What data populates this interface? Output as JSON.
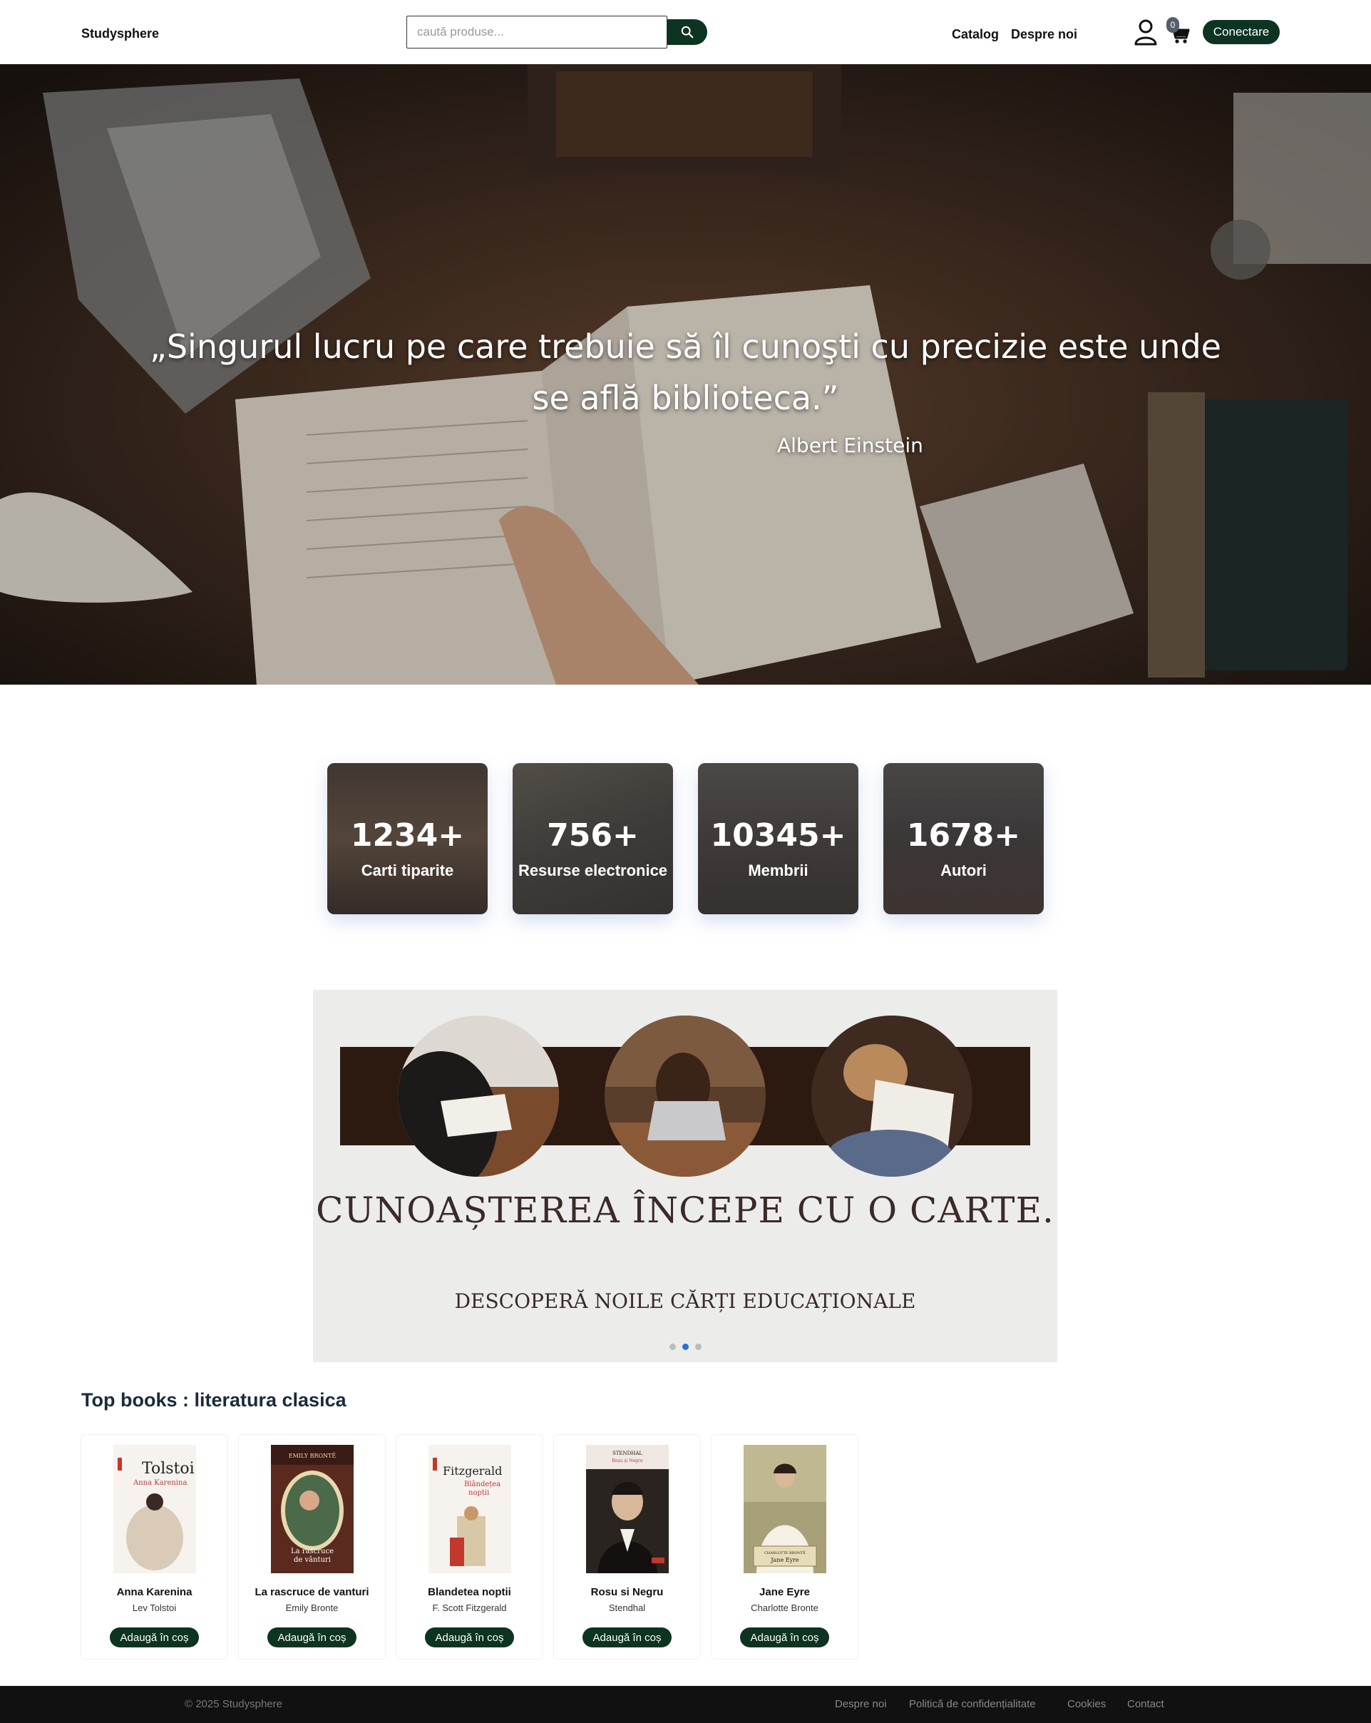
{
  "nav": {
    "brand": "Studysphere",
    "search_placeholder": "caută produse...",
    "links": [
      "Catalog",
      "Despre noi"
    ],
    "cart_count": "0",
    "login_label": "Conectare"
  },
  "hero": {
    "quote": "„Singurul lucru pe care trebuie să îl cunoşti cu precizie este unde se află biblioteca.”",
    "author": "Albert Einstein"
  },
  "stats": [
    {
      "number": "1234+",
      "label": "Carti tiparite"
    },
    {
      "number": "756+",
      "label": "Resurse electronice"
    },
    {
      "number": "10345+",
      "label": "Membrii"
    },
    {
      "number": "1678+",
      "label": "Autori"
    }
  ],
  "carousel": {
    "title": "CUNOAȘTEREA ÎNCEPE CU O CARTE.",
    "subtitle": "DESCOPERĂ NOILE CĂRȚI EDUCAȚIONALE",
    "slide_count": 3,
    "active_slide": 2
  },
  "top_books": {
    "heading": "Top books : literatura clasica",
    "add_label": "Adaugă în coș",
    "items": [
      {
        "title": "Anna Karenina",
        "author": "Lev Tolstoi"
      },
      {
        "title": "La rascruce de vanturi",
        "author": "Emily Bronte"
      },
      {
        "title": "Blandetea noptii",
        "author": "F. Scott Fitzgerald"
      },
      {
        "title": "Rosu si Negru",
        "author": "Stendhal"
      },
      {
        "title": "Jane Eyre",
        "author": "Charlotte Bronte"
      }
    ]
  },
  "footer": {
    "copyright": "© 2025 Studysphere",
    "links": [
      "Despre noi",
      "Politică de confidențialitate",
      "Cookies",
      "Contact"
    ]
  },
  "colors": {
    "accent": "#0d3321",
    "footer_bg": "#111111",
    "carousel_band": "#2c1a11",
    "active_dot": "#2a6fe0"
  }
}
